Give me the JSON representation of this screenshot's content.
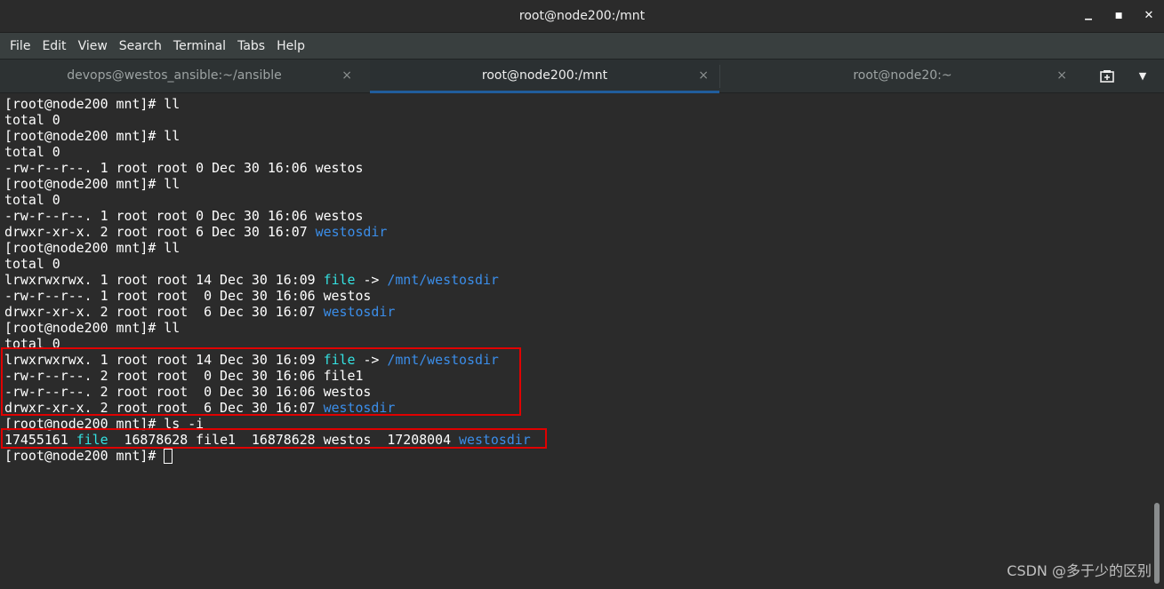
{
  "window": {
    "title": "root@node200:/mnt",
    "minimize_glyph": "▁",
    "maximize_glyph": "■",
    "close_glyph": "✕"
  },
  "menu": [
    "File",
    "Edit",
    "View",
    "Search",
    "Terminal",
    "Tabs",
    "Help"
  ],
  "tabs": [
    {
      "label": "devops@westos_ansible:~/ansible",
      "close": "×",
      "active": false
    },
    {
      "label": "root@node200:/mnt",
      "close": "×",
      "active": true
    },
    {
      "label": "root@node20:~",
      "close": "×",
      "active": false
    }
  ],
  "tab_tools": {
    "new_tab_icon": "new-tab-icon",
    "new_tab_glyph": "⊕",
    "menu_glyph": "▼"
  },
  "terminal": {
    "lines": [
      [
        {
          "t": "[root@node200 mnt]# ll"
        }
      ],
      [
        {
          "t": "total 0"
        }
      ],
      [
        {
          "t": "[root@node200 mnt]# ll"
        }
      ],
      [
        {
          "t": "total 0"
        }
      ],
      [
        {
          "t": "-rw-r--r--. 1 root root 0 Dec 30 16:06 westos"
        }
      ],
      [
        {
          "t": "[root@node200 mnt]# ll"
        }
      ],
      [
        {
          "t": "total 0"
        }
      ],
      [
        {
          "t": "-rw-r--r--. 1 root root 0 Dec 30 16:06 westos"
        }
      ],
      [
        {
          "t": "drwxr-xr-x. 2 root root 6 Dec 30 16:07 "
        },
        {
          "t": "westosdir",
          "c": "dir"
        }
      ],
      [
        {
          "t": "[root@node200 mnt]# ll"
        }
      ],
      [
        {
          "t": "total 0"
        }
      ],
      [
        {
          "t": "lrwxrwxrwx. 1 root root 14 Dec 30 16:09 "
        },
        {
          "t": "file",
          "c": "link"
        },
        {
          "t": " -> "
        },
        {
          "t": "/mnt/westosdir",
          "c": "dir"
        }
      ],
      [
        {
          "t": "-rw-r--r--. 1 root root  0 Dec 30 16:06 westos"
        }
      ],
      [
        {
          "t": "drwxr-xr-x. 2 root root  6 Dec 30 16:07 "
        },
        {
          "t": "westosdir",
          "c": "dir"
        }
      ],
      [
        {
          "t": "[root@node200 mnt]# ll"
        }
      ],
      [
        {
          "t": "total 0"
        }
      ],
      [
        {
          "t": "lrwxrwxrwx. 1 root root 14 Dec 30 16:09 "
        },
        {
          "t": "file",
          "c": "link"
        },
        {
          "t": " -> "
        },
        {
          "t": "/mnt/westosdir",
          "c": "dir"
        }
      ],
      [
        {
          "t": "-rw-r--r--. 2 root root  0 Dec 30 16:06 file1"
        }
      ],
      [
        {
          "t": "-rw-r--r--. 2 root root  0 Dec 30 16:06 westos"
        }
      ],
      [
        {
          "t": "drwxr-xr-x. 2 root root  6 Dec 30 16:07 "
        },
        {
          "t": "westosdir",
          "c": "dir"
        }
      ],
      [
        {
          "t": "[root@node200 mnt]# ls -i"
        }
      ],
      [
        {
          "t": "17455161 "
        },
        {
          "t": "file",
          "c": "link"
        },
        {
          "t": "  16878628 file1  16878628 westos  17208004 "
        },
        {
          "t": "westosdir",
          "c": "dir"
        }
      ],
      [
        {
          "t": "[root@node200 mnt]# "
        },
        {
          "cursor": true
        }
      ]
    ]
  },
  "colors": {
    "link": "#34e2e2",
    "dir": "#3b8eea",
    "highlight_box": "#e00000",
    "tab_active_underline": "#215d9c"
  },
  "watermark": "CSDN @多于少的区别"
}
